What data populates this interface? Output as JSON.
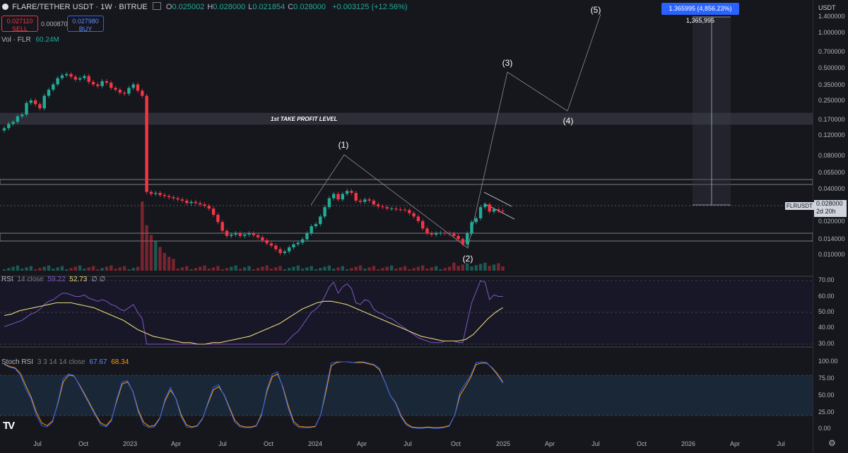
{
  "header": {
    "symbol": "FLARE/TETHER USDT · 1W · BITRUE",
    "ohlc": [
      {
        "k": "O",
        "v": "0.025002"
      },
      {
        "k": "H",
        "v": "0.028000"
      },
      {
        "k": "L",
        "v": "0.021854"
      },
      {
        "k": "C",
        "v": "0.028000"
      }
    ],
    "change": "+0.003125 (+12.56%)"
  },
  "trade": {
    "sell_price": "0.027110",
    "sell_label": "SELL",
    "spread": "0.000870",
    "buy_price": "0.027980",
    "buy_label": "BUY"
  },
  "legends": {
    "vol": "Vol · FLR",
    "vol_value": "60.24M",
    "rsi_label": "RSI",
    "rsi_params": "14 close",
    "rsi_value": "59.22",
    "rsi_ma": "52.73",
    "rsi_extra": "∅ ∅",
    "stoch_label": "Stoch RSI",
    "stoch_params": "3 3 14 14 close",
    "stoch_k": "67.67",
    "stoch_d": "68.34"
  },
  "annotations": {
    "take_profit": "1st TAKE PROFIT LEVEL",
    "waves": [
      "(1)",
      "(2)",
      "(3)",
      "(4)",
      "(5)"
    ],
    "measure": "1.365995 (4,856.23%) 1,365,995"
  },
  "price_tag": {
    "symbol": "FLRUSDT",
    "price": "0.028000",
    "countdown": "2d 20h"
  },
  "axis": {
    "unit": "USDT",
    "price_ticks": [
      "1.400000",
      "1.000000",
      "0.700000",
      "0.500000",
      "0.350000",
      "0.250000",
      "0.170000",
      "0.120000",
      "0.080000",
      "0.055000",
      "0.040000",
      "0.020000",
      "0.014000",
      "0.010000"
    ],
    "rsi_ticks": [
      "70.00",
      "60.00",
      "50.00",
      "40.00",
      "30.00"
    ],
    "stoch_ticks": [
      "100.00",
      "75.00",
      "50.00",
      "25.00",
      "0.00"
    ],
    "time_ticks": [
      "Jul",
      "Oct",
      "2023",
      "Apr",
      "Jul",
      "Oct",
      "2024",
      "Apr",
      "Jul",
      "Oct",
      "2025",
      "Apr",
      "Jul",
      "Oct",
      "2026",
      "Apr",
      "Jul"
    ]
  },
  "colors": {
    "up": "#22ab94",
    "down": "#f23645",
    "rsi": "#7e57c2",
    "rsi_ma": "#e8d67a",
    "stoch_k": "#2962ff",
    "stoch_d": "#ff9800",
    "measure": "#2962ff"
  },
  "icons": {
    "logo": "tradingview-logo-icon",
    "settings": "gear-icon",
    "toggle": "panel-toggle-icon"
  },
  "chart_data": {
    "type": "candlestick",
    "title": "FLARE/TETHER USDT · 1W · BITRUE",
    "y_scale": "log",
    "weekly_close": [
      0.19,
      0.21,
      0.22,
      0.25,
      0.26,
      0.34,
      0.36,
      0.33,
      0.3,
      0.4,
      0.46,
      0.52,
      0.6,
      0.64,
      0.66,
      0.62,
      0.58,
      0.6,
      0.63,
      0.55,
      0.52,
      0.5,
      0.56,
      0.54,
      0.48,
      0.46,
      0.43,
      0.42,
      0.48,
      0.52,
      0.45,
      0.4,
      0.044,
      0.042,
      0.043,
      0.041,
      0.04,
      0.039,
      0.038,
      0.037,
      0.036,
      0.034,
      0.035,
      0.034,
      0.033,
      0.032,
      0.03,
      0.026,
      0.022,
      0.018,
      0.016,
      0.0165,
      0.017,
      0.016,
      0.0165,
      0.017,
      0.0163,
      0.0155,
      0.0145,
      0.0135,
      0.0128,
      0.0118,
      0.0108,
      0.0112,
      0.0123,
      0.0132,
      0.0137,
      0.0148,
      0.017,
      0.02,
      0.021,
      0.025,
      0.031,
      0.038,
      0.042,
      0.037,
      0.042,
      0.045,
      0.043,
      0.036,
      0.035,
      0.037,
      0.036,
      0.033,
      0.0315,
      0.031,
      0.03,
      0.03,
      0.0295,
      0.0293,
      0.029,
      0.027,
      0.025,
      0.0225,
      0.019,
      0.017,
      0.0165,
      0.017,
      0.0172,
      0.017,
      0.0168,
      0.016,
      0.0149,
      0.0132,
      0.017,
      0.022,
      0.024,
      0.031,
      0.033,
      0.028,
      0.0295,
      0.0285,
      0.028
    ],
    "volume_levels": [
      0.35,
      0.23,
      0.18,
      0.15,
      0.12,
      0.09,
      0.07,
      0.06
    ],
    "rsi_close": [
      41,
      42,
      43,
      44,
      45,
      47,
      49,
      50,
      52,
      55,
      57,
      58,
      60,
      62,
      62,
      61,
      60,
      60,
      61,
      59,
      58,
      57,
      58,
      57,
      55,
      54,
      52,
      51,
      53,
      55,
      50,
      46,
      30,
      30,
      30,
      30,
      30,
      30,
      30,
      30,
      30,
      30,
      30,
      30,
      30,
      30,
      30,
      30,
      30,
      30,
      30,
      30,
      30,
      30,
      30,
      30,
      30,
      30,
      30,
      30,
      30,
      30,
      30,
      30,
      33,
      36,
      38,
      42,
      46,
      50,
      52,
      55,
      60,
      66,
      69,
      62,
      66,
      68,
      65,
      56,
      55,
      58,
      57,
      52,
      50,
      49,
      47,
      46,
      44,
      42,
      40,
      38,
      36,
      34,
      33,
      32,
      31,
      31,
      31,
      32,
      32,
      32,
      31,
      31,
      44,
      56,
      63,
      70,
      69,
      58,
      61,
      60,
      60
    ],
    "rsi_ma": [
      48,
      49,
      51,
      52,
      53,
      54,
      55,
      56,
      56,
      56,
      55,
      54,
      53,
      51,
      49,
      47,
      45,
      42,
      39,
      37,
      35,
      34,
      33,
      32,
      31,
      31,
      30,
      30,
      31,
      31,
      32,
      33,
      34,
      35,
      37,
      39,
      41,
      43,
      46,
      49,
      52,
      54,
      56,
      57,
      57,
      56,
      55,
      53,
      51,
      49,
      47,
      45,
      43,
      41,
      39,
      37,
      35,
      34,
      33,
      32,
      32,
      32,
      33,
      36,
      41,
      46,
      50,
      53
    ],
    "stoch_k": [
      96,
      92,
      90,
      80,
      60,
      45,
      20,
      5,
      3,
      10,
      40,
      75,
      82,
      80,
      65,
      50,
      35,
      20,
      6,
      3,
      12,
      45,
      70,
      72,
      55,
      25,
      6,
      2,
      3,
      15,
      45,
      62,
      45,
      18,
      3,
      2,
      4,
      15,
      40,
      62,
      66,
      50,
      30,
      10,
      3,
      2,
      2,
      4,
      20,
      60,
      82,
      85,
      60,
      30,
      8,
      2,
      2,
      2,
      3,
      20,
      60,
      98,
      100,
      100,
      100,
      99,
      100,
      100,
      98,
      96,
      90,
      70,
      50,
      38,
      18,
      6,
      2,
      1,
      1,
      2,
      1,
      1,
      2,
      4,
      20,
      55,
      68,
      80,
      99,
      100,
      99,
      90,
      80,
      68
    ],
    "stoch_d": [
      97,
      93,
      91,
      83,
      65,
      48,
      25,
      9,
      5,
      12,
      38,
      70,
      80,
      79,
      66,
      52,
      37,
      22,
      9,
      5,
      14,
      42,
      67,
      70,
      56,
      28,
      10,
      4,
      5,
      16,
      42,
      58,
      46,
      21,
      6,
      3,
      5,
      16,
      38,
      58,
      63,
      51,
      32,
      13,
      5,
      3,
      3,
      5,
      22,
      56,
      78,
      82,
      62,
      34,
      11,
      4,
      3,
      3,
      4,
      20,
      55,
      94,
      99,
      100,
      100,
      99,
      99,
      99,
      97,
      95,
      88,
      70,
      50,
      39,
      20,
      8,
      3,
      2,
      2,
      3,
      2,
      2,
      3,
      5,
      20,
      50,
      63,
      77,
      96,
      98,
      98,
      91,
      82,
      70
    ]
  }
}
